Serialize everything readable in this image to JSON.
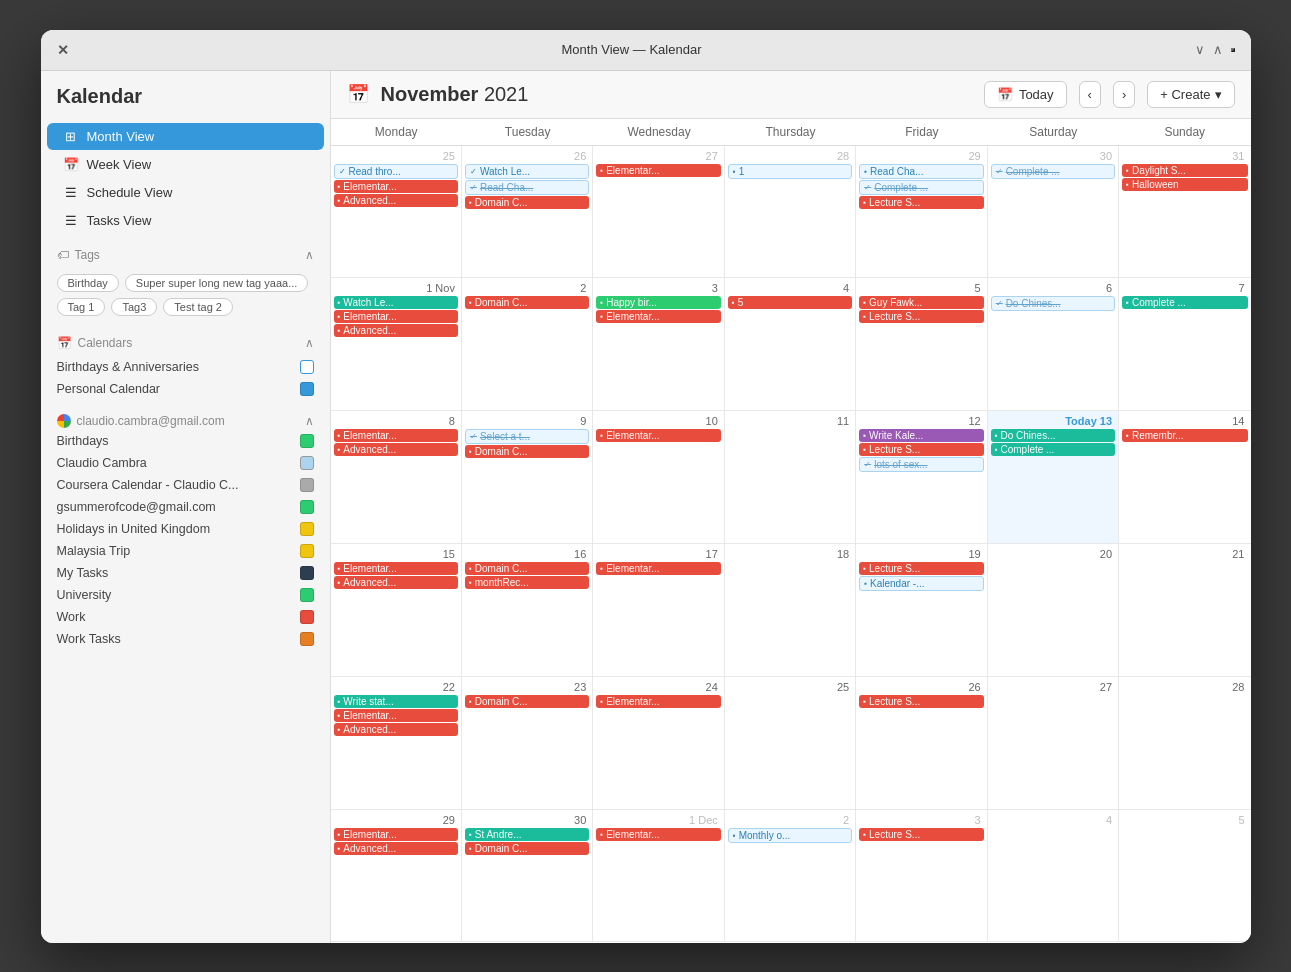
{
  "app": {
    "title": "Month View — Kalendar",
    "name": "Kalendar"
  },
  "header": {
    "month": "November",
    "year": "2021",
    "today_label": "Today",
    "create_label": "+ Create"
  },
  "sidebar": {
    "nav_items": [
      {
        "id": "month-view",
        "label": "Month View",
        "active": true
      },
      {
        "id": "week-view",
        "label": "Week View",
        "active": false
      },
      {
        "id": "schedule-view",
        "label": "Schedule View",
        "active": false
      },
      {
        "id": "tasks-view",
        "label": "Tasks View",
        "active": false
      }
    ],
    "tags_section": "Tags",
    "tags": [
      "Birthday",
      "Super super long new tag yaaa...",
      "Tag 1",
      "Tag3",
      "Test tag 2"
    ],
    "calendars_section": "Calendars",
    "calendars": [
      {
        "label": "Birthdays & Anniversaries",
        "color": "outline"
      },
      {
        "label": "Personal Calendar",
        "color": "#3498db"
      }
    ],
    "google_account": "claudio.cambra@gmail.com",
    "google_calendars": [
      {
        "label": "Birthdays",
        "color": "#2ecc71"
      },
      {
        "label": "Claudio Cambra",
        "color": "#aad4f0"
      },
      {
        "label": "Coursera Calendar - Claudio C...",
        "color": "#aaa"
      },
      {
        "label": "gsummerofcode@gmail.com",
        "color": "#2ecc71"
      },
      {
        "label": "Holidays in United Kingdom",
        "color": "#f1c40f"
      },
      {
        "label": "Malaysia Trip",
        "color": "#f1c40f"
      },
      {
        "label": "My Tasks",
        "color": "#2c3e50"
      },
      {
        "label": "University",
        "color": "#2ecc71"
      },
      {
        "label": "Work",
        "color": "#e74c3c"
      },
      {
        "label": "Work Tasks",
        "color": "#e67e22"
      }
    ]
  },
  "days_of_week": [
    "Monday",
    "Tuesday",
    "Wednesday",
    "Thursday",
    "Friday",
    "Saturday",
    "Sunday"
  ],
  "weeks": [
    {
      "days": [
        {
          "num": "25",
          "other": true,
          "events": [
            {
              "text": "Read thro...",
              "color": "blue-outline",
              "icon": "✓"
            },
            {
              "text": "Elementar...",
              "color": "red",
              "icon": "📅"
            },
            {
              "text": "Advanced...",
              "color": "red",
              "icon": "📅"
            }
          ]
        },
        {
          "num": "26",
          "other": true,
          "events": [
            {
              "text": "Watch Le...",
              "color": "blue-outline",
              "icon": "✓"
            },
            {
              "text": "Read Cha...",
              "color": "blue-outline",
              "icon": "✓",
              "strike": true
            },
            {
              "text": "Domain C...",
              "color": "red",
              "icon": "📅"
            }
          ]
        },
        {
          "num": "27",
          "other": true,
          "events": [
            {
              "text": "Elementar...",
              "color": "red",
              "icon": "📅"
            }
          ]
        },
        {
          "num": "28",
          "other": true,
          "events": [
            {
              "text": "1",
              "color": "blue-outline",
              "icon": "📅"
            }
          ]
        },
        {
          "num": "29",
          "other": true,
          "events": [
            {
              "text": "Read Cha...",
              "color": "blue-outline",
              "icon": "📋"
            },
            {
              "text": "Complete ...",
              "color": "blue-outline",
              "icon": "✓",
              "strike": true
            },
            {
              "text": "Lecture S...",
              "color": "red",
              "icon": "📅"
            }
          ]
        },
        {
          "num": "30",
          "other": true,
          "events": [
            {
              "text": "Complete ...",
              "color": "blue-outline",
              "icon": "✓",
              "strike": true
            }
          ]
        },
        {
          "num": "31",
          "other": true,
          "events": [
            {
              "text": "Daylight S...",
              "color": "red",
              "icon": "📅"
            },
            {
              "text": "Halloween",
              "color": "red",
              "icon": "📅"
            }
          ]
        }
      ]
    },
    {
      "days": [
        {
          "num": "1 Nov",
          "events": [
            {
              "text": "Watch Le...",
              "color": "teal",
              "icon": "📅"
            },
            {
              "text": "Elementar...",
              "color": "red",
              "icon": "📅"
            },
            {
              "text": "Advanced...",
              "color": "red",
              "icon": "📅"
            }
          ]
        },
        {
          "num": "2",
          "events": [
            {
              "text": "Domain C...",
              "color": "red",
              "icon": "📅"
            }
          ]
        },
        {
          "num": "3",
          "events": [
            {
              "text": "Happy bir...",
              "color": "green",
              "icon": "📅"
            },
            {
              "text": "Elementar...",
              "color": "red",
              "icon": "📅"
            }
          ]
        },
        {
          "num": "4",
          "events": [
            {
              "text": "5",
              "color": "red",
              "icon": "📅"
            }
          ]
        },
        {
          "num": "5",
          "events": [
            {
              "text": "Guy Fawk...",
              "color": "red",
              "icon": "📅"
            },
            {
              "text": "Lecture S...",
              "color": "red",
              "icon": "📅"
            }
          ]
        },
        {
          "num": "6",
          "events": [
            {
              "text": "Do Chines...",
              "color": "blue-outline",
              "icon": "✓",
              "strike": true
            }
          ]
        },
        {
          "num": "7",
          "events": [
            {
              "text": "Complete ...",
              "color": "teal",
              "icon": "📅"
            }
          ]
        }
      ]
    },
    {
      "days": [
        {
          "num": "8",
          "events": [
            {
              "text": "Elementar...",
              "color": "red",
              "icon": "📅"
            },
            {
              "text": "Advanced...",
              "color": "red",
              "icon": "📅"
            }
          ]
        },
        {
          "num": "9",
          "events": [
            {
              "text": "Select a t...",
              "color": "blue-outline",
              "icon": "✓",
              "strike": true
            },
            {
              "text": "Domain C...",
              "color": "red",
              "icon": "📅"
            }
          ]
        },
        {
          "num": "10",
          "events": [
            {
              "text": "Elementar...",
              "color": "red",
              "icon": "📅"
            }
          ]
        },
        {
          "num": "11",
          "events": []
        },
        {
          "num": "12",
          "events": [
            {
              "text": "Write Kale...",
              "color": "purple",
              "icon": "📋"
            },
            {
              "text": "Lecture S...",
              "color": "red",
              "icon": "📅"
            },
            {
              "text": "lots of sex...",
              "color": "blue-outline",
              "icon": "✓",
              "strike": true
            }
          ]
        },
        {
          "num": "13",
          "today": true,
          "events": [
            {
              "text": "Do Chines...",
              "color": "teal",
              "icon": "📅"
            },
            {
              "text": "Complete ...",
              "color": "teal",
              "icon": "📅"
            }
          ]
        },
        {
          "num": "14",
          "events": [
            {
              "text": "Remembr...",
              "color": "red",
              "icon": "📅"
            }
          ]
        }
      ]
    },
    {
      "days": [
        {
          "num": "15",
          "events": [
            {
              "text": "Elementar...",
              "color": "red",
              "icon": "📅"
            },
            {
              "text": "Advanced...",
              "color": "red",
              "icon": "📅"
            }
          ]
        },
        {
          "num": "16",
          "events": [
            {
              "text": "Domain C...",
              "color": "red",
              "icon": "📅"
            },
            {
              "text": "monthRec...",
              "color": "red",
              "icon": "📅"
            }
          ]
        },
        {
          "num": "17",
          "events": [
            {
              "text": "Elementar...",
              "color": "red",
              "icon": "📅"
            }
          ]
        },
        {
          "num": "18",
          "events": []
        },
        {
          "num": "19",
          "events": [
            {
              "text": "Lecture S...",
              "color": "red",
              "icon": "📅"
            },
            {
              "text": "Kalendar -...",
              "color": "blue-outline",
              "icon": "📅"
            }
          ]
        },
        {
          "num": "20",
          "events": []
        },
        {
          "num": "21",
          "events": []
        }
      ]
    },
    {
      "days": [
        {
          "num": "22",
          "events": [
            {
              "text": "Write stat...",
              "color": "teal",
              "icon": "📅"
            },
            {
              "text": "Elementar...",
              "color": "red",
              "icon": "📅"
            },
            {
              "text": "Advanced...",
              "color": "red",
              "icon": "📅"
            }
          ]
        },
        {
          "num": "23",
          "events": [
            {
              "text": "Domain C...",
              "color": "red",
              "icon": "📅"
            }
          ]
        },
        {
          "num": "24",
          "events": [
            {
              "text": "Elementar...",
              "color": "red",
              "icon": "📅"
            }
          ]
        },
        {
          "num": "25",
          "events": []
        },
        {
          "num": "26",
          "events": [
            {
              "text": "Lecture S...",
              "color": "red",
              "icon": "📅"
            }
          ]
        },
        {
          "num": "27",
          "events": []
        },
        {
          "num": "28",
          "events": []
        }
      ]
    },
    {
      "days": [
        {
          "num": "29",
          "events": [
            {
              "text": "Elementar...",
              "color": "red",
              "icon": "📅"
            },
            {
              "text": "Advanced...",
              "color": "red",
              "icon": "📅"
            }
          ]
        },
        {
          "num": "30",
          "events": [
            {
              "text": "St Andre...",
              "color": "teal",
              "icon": "📅"
            },
            {
              "text": "Domain C...",
              "color": "red",
              "icon": "📅"
            }
          ]
        },
        {
          "num": "1 Dec",
          "other": true,
          "events": [
            {
              "text": "Elementar...",
              "color": "red",
              "icon": "📅"
            }
          ]
        },
        {
          "num": "2",
          "other": true,
          "events": [
            {
              "text": "Monthly o...",
              "color": "blue-outline",
              "icon": "📅"
            }
          ]
        },
        {
          "num": "3",
          "other": true,
          "events": [
            {
              "text": "Lecture S...",
              "color": "red",
              "icon": "📅"
            }
          ]
        },
        {
          "num": "4",
          "other": true,
          "events": []
        },
        {
          "num": "5",
          "other": true,
          "events": []
        }
      ]
    }
  ]
}
